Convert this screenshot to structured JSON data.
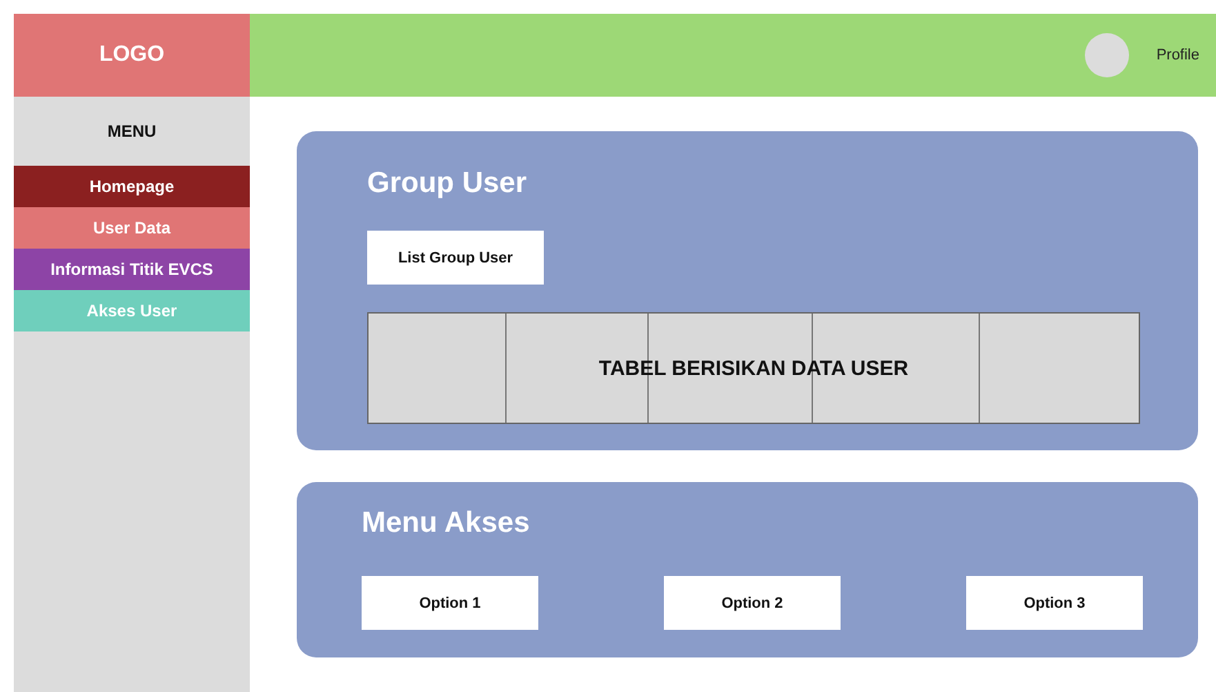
{
  "sidebar": {
    "logo": "LOGO",
    "menu_title": "MENU",
    "items": [
      {
        "label": "Homepage",
        "color": "#8b2020"
      },
      {
        "label": "User Data",
        "color": "#e07575"
      },
      {
        "label": "Informasi Titik EVCS",
        "color": "#8d44a6"
      },
      {
        "label": "Akses User",
        "color": "#6fcfbc"
      }
    ]
  },
  "header": {
    "profile": "Profile"
  },
  "group_user": {
    "title": "Group User",
    "button": "List Group User",
    "table": {
      "caption": "TABEL BERISIKAN DATA USER"
    }
  },
  "menu_akses": {
    "title": "Menu Akses",
    "options": [
      "Option 1",
      "Option 2",
      "Option 3"
    ]
  }
}
